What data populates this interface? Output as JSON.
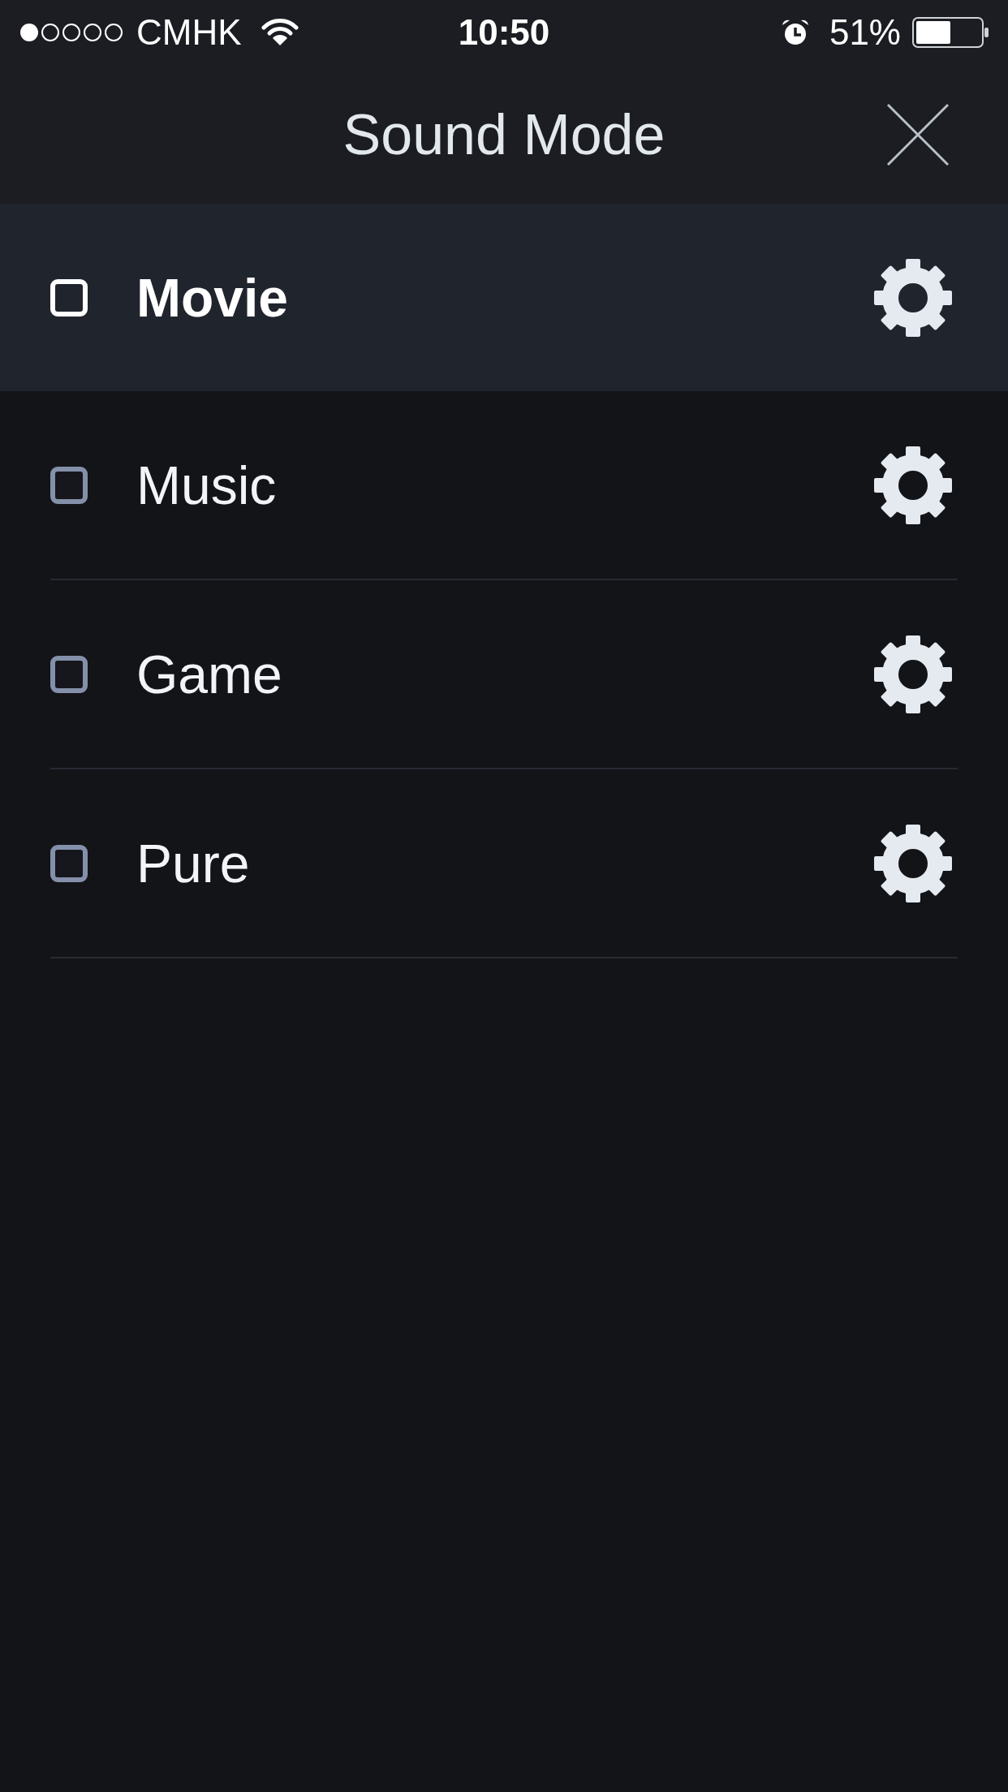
{
  "status_bar": {
    "carrier": "CMHK",
    "time": "10:50",
    "battery": "51%"
  },
  "header": {
    "title": "Sound Mode"
  },
  "modes": [
    {
      "label": "Movie",
      "selected": true
    },
    {
      "label": "Music",
      "selected": false
    },
    {
      "label": "Game",
      "selected": false
    },
    {
      "label": "Pure",
      "selected": false
    }
  ]
}
